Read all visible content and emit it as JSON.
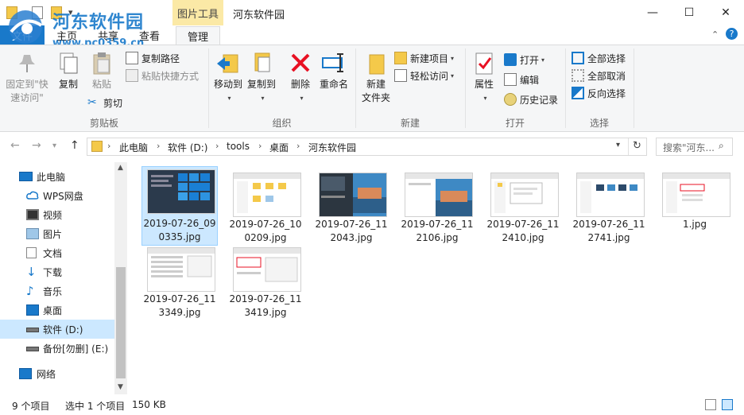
{
  "window": {
    "tool_tab": "图片工具",
    "title": "河东软件园",
    "minimize": "—",
    "maximize": "☐",
    "close": "✕"
  },
  "tabs": {
    "file": "文件",
    "home": "主页",
    "share": "共享",
    "view": "查看",
    "manage": "管理"
  },
  "ribbon": {
    "clipboard": {
      "label": "剪贴板",
      "pin_line1": "固定到\"快",
      "pin_line2": "速访问\"",
      "copy": "复制",
      "paste": "粘贴",
      "copy_path": "复制路径",
      "paste_shortcut": "粘贴快捷方式",
      "cut": "剪切"
    },
    "organize": {
      "label": "组织",
      "move_to": "移动到",
      "copy_to": "复制到",
      "delete": "删除",
      "rename": "重命名"
    },
    "new": {
      "label": "新建",
      "new_folder_line1": "新建",
      "new_folder_line2": "文件夹",
      "new_item": "新建项目",
      "easy_access": "轻松访问"
    },
    "open": {
      "label": "打开",
      "properties": "属性",
      "open": "打开",
      "edit": "编辑",
      "history": "历史记录"
    },
    "select": {
      "label": "选择",
      "select_all": "全部选择",
      "select_none": "全部取消",
      "invert": "反向选择"
    }
  },
  "address": {
    "crumbs": [
      "此电脑",
      "软件 (D:)",
      "tools",
      "桌面",
      "河东软件园"
    ],
    "search_placeholder": "搜索\"河东..."
  },
  "nav": {
    "items": [
      {
        "label": "此电脑",
        "icon": "computer-icon"
      },
      {
        "label": "WPS网盘",
        "icon": "cloud-icon"
      },
      {
        "label": "视频",
        "icon": "video-icon"
      },
      {
        "label": "图片",
        "icon": "picture-icon"
      },
      {
        "label": "文档",
        "icon": "document-icon"
      },
      {
        "label": "下载",
        "icon": "download-icon"
      },
      {
        "label": "音乐",
        "icon": "music-icon"
      },
      {
        "label": "桌面",
        "icon": "desktop-icon"
      },
      {
        "label": "软件 (D:)",
        "icon": "drive-icon"
      },
      {
        "label": "备份[勿删] (E:)",
        "icon": "drive-icon"
      },
      {
        "label": "网络",
        "icon": "network-icon"
      }
    ]
  },
  "files": [
    {
      "name": "2019-07-26_090335.jpg",
      "selected": true
    },
    {
      "name": "2019-07-26_100209.jpg"
    },
    {
      "name": "2019-07-26_112043.jpg"
    },
    {
      "name": "2019-07-26_112106.jpg"
    },
    {
      "name": "2019-07-26_112410.jpg"
    },
    {
      "name": "2019-07-26_112741.jpg"
    },
    {
      "name": "1.jpg"
    },
    {
      "name": "2019-07-26_113349.jpg"
    },
    {
      "name": "2019-07-26_113419.jpg"
    }
  ],
  "status": {
    "item_count": "9 个项目",
    "selection": "选中 1 个项目",
    "size": "150 KB"
  },
  "watermark": {
    "brand": "河东软件园",
    "url": "www.pc0359.cn"
  },
  "colors": {
    "accent": "#1979ca",
    "selection": "#cce8ff",
    "tool_tab": "#fbe9a6",
    "delete_red": "#e81123"
  }
}
